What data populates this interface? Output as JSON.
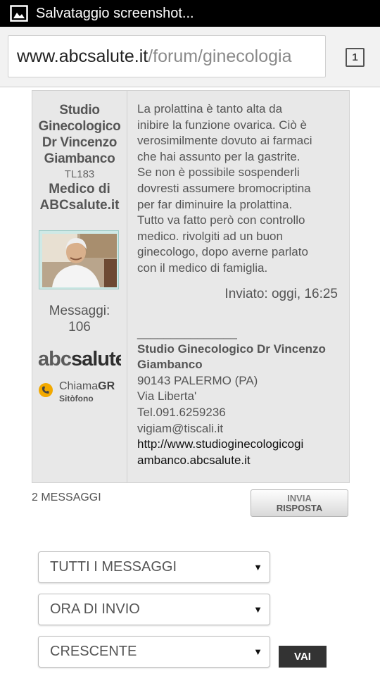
{
  "status_bar": {
    "icon": "image-icon",
    "text": "Salvataggio screenshot..."
  },
  "browser": {
    "url_host": "www.abcsalute.it",
    "url_path": "/forum/ginecologia",
    "tab_count": "1"
  },
  "post": {
    "author": {
      "name_lines": [
        "Studio",
        "Ginecologico",
        "Dr Vincenzo",
        "Giambanco"
      ],
      "id": "TL183",
      "role_lines": [
        "Medico di",
        "ABCsalute.it"
      ],
      "messages_label": "Messaggi:",
      "messages_count": "106"
    },
    "logos": {
      "abc_part": "abc",
      "salute_part": "salute",
      "chiama_part": "Chiama",
      "gr_part": "GR",
      "sitofono": "Sitòfono"
    },
    "body": "La prolattina è tanto alta da\ninibire la funzione ovarica. Ciò è\nverosimilmente dovuto ai farmaci\nche hai assunto per la gastrite.\nSe non è possibile sospenderli\ndovresti assumere bromocriptina\nper far diminuire la prolattina.\nTutto va fatto però con controllo\nmedico. rivolgiti ad un buon\nginecologo, dopo averne parlato\ncon il medico di famiglia.",
    "date": "Inviato: oggi, 16:25",
    "signature": {
      "separator": "_______________",
      "name_lines": [
        "Studio Ginecologico Dr Vincenzo",
        "Giambanco"
      ],
      "address": "90143 PALERMO (PA)",
      "street": "Via Liberta'",
      "phone": "Tel.091.6259236",
      "email": "vigiam@tiscali.it",
      "website_lines": [
        "http://www.studioginecologicogi",
        "ambanco.abcsalute.it"
      ]
    }
  },
  "thread": {
    "messages_total": "2 MESSAGGI",
    "reply_line1": "INVIA",
    "reply_line2": "RISPOSTA"
  },
  "filters": {
    "show": "TUTTI I MESSAGGI",
    "sort_by": "ORA DI INVIO",
    "order": "CRESCENTE",
    "go_label": "VAI"
  }
}
